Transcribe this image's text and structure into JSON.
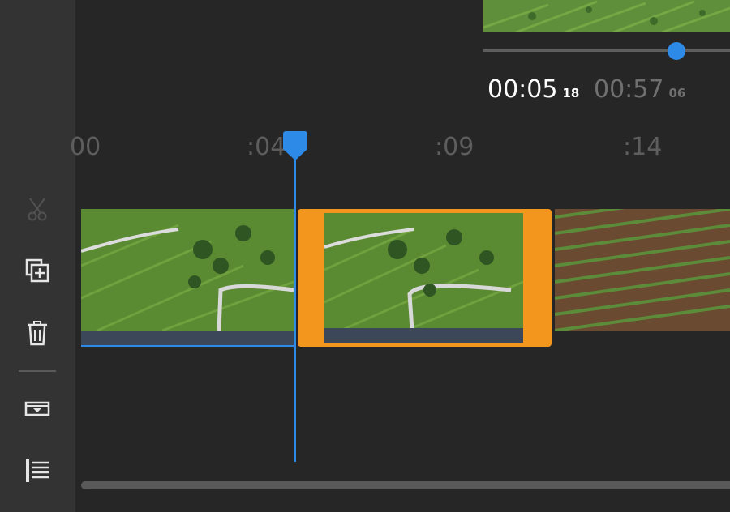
{
  "preview": {
    "current_time": "00:05",
    "current_frames": "18",
    "total_time": "00:57",
    "total_frames": "06"
  },
  "ruler": {
    "labels": [
      "00",
      ":04",
      ":09",
      ":14"
    ]
  },
  "tools": [
    "scissors-icon",
    "duplicate-icon",
    "trash-icon",
    "insert-track-icon",
    "align-left-icon"
  ],
  "colors": {
    "accent": "#2d8ae6",
    "selection": "#f3961e",
    "panel": "#333333",
    "background": "#262626"
  }
}
